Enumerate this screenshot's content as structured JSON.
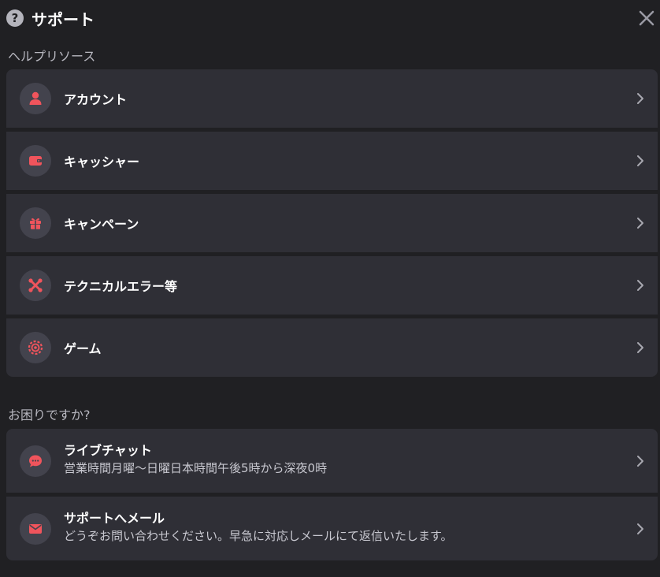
{
  "header": {
    "help_glyph": "?",
    "title": "サポート"
  },
  "sections": {
    "resources_label": "ヘルプリソース",
    "trouble_label": "お困りですか?"
  },
  "resources": [
    {
      "label": "アカウント",
      "icon": "user-icon"
    },
    {
      "label": "キャッシャー",
      "icon": "wallet-icon"
    },
    {
      "label": "キャンペーン",
      "icon": "gift-icon"
    },
    {
      "label": "テクニカルエラー等",
      "icon": "tools-icon"
    },
    {
      "label": "ゲーム",
      "icon": "chip-icon"
    }
  ],
  "contact": [
    {
      "title": "ライブチャット",
      "subtitle": "営業時間月曜〜日曜日本時間午後5時から深夜0時",
      "icon": "chat-icon"
    },
    {
      "title": "サポートへメール",
      "subtitle": "どうぞお問い合わせください。早急に対応しメールにて返信いたします。",
      "icon": "mail-icon"
    }
  ],
  "colors": {
    "background": "#202023",
    "row": "#2f2f36",
    "icon_circle": "#43434d",
    "accent": "#f0545c",
    "muted_text": "#b8b8c0"
  }
}
